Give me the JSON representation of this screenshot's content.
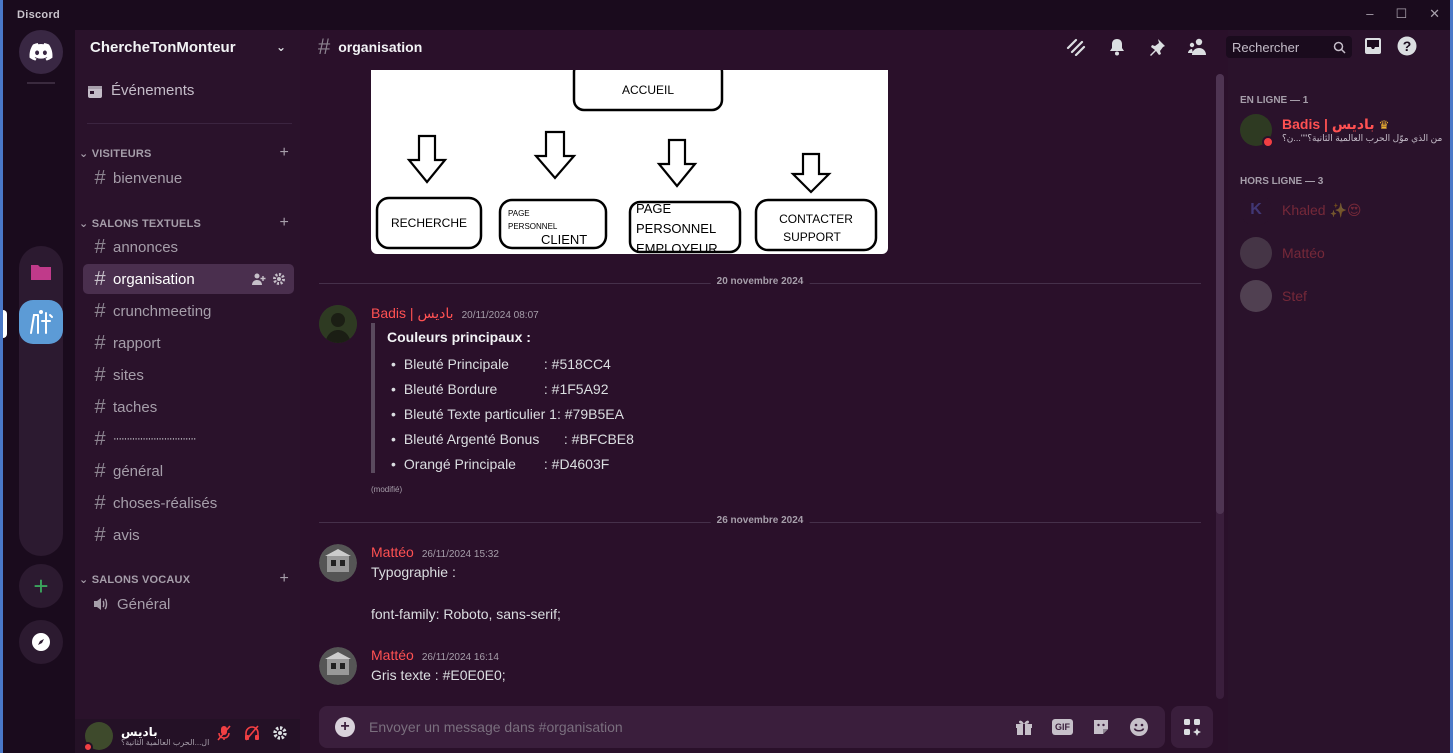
{
  "window": {
    "title": "Discord"
  },
  "server": {
    "name": "ChercheTonMonteur"
  },
  "sidebar": {
    "events_label": "Événements",
    "categories": [
      {
        "label": "VISITEURS",
        "channels": [
          "bienvenue"
        ]
      },
      {
        "label": "SALONS TEXTUELS",
        "channels": [
          "annonces",
          "organisation",
          "crunchmeeting",
          "rapport",
          "sites",
          "taches",
          "·······························",
          "général",
          "choses-réalisés",
          "avis"
        ]
      },
      {
        "label": "SALONS VOCAUX",
        "channels": [
          "Général"
        ]
      }
    ]
  },
  "user": {
    "name": "باديس",
    "status": "ال...الحرب العالمية الثانية؟"
  },
  "channel": {
    "name": "organisation"
  },
  "image": {
    "boxes": [
      "ACCUEIL",
      "RECHERCHE",
      "PAGE PERSONNEL",
      "CLIENT",
      "PAGE PERSONNEL EMPLOYEUR",
      "CONTACTER SUPPORT"
    ]
  },
  "dividers": [
    "20 novembre 2024",
    "26 novembre 2024"
  ],
  "messages": [
    {
      "author": "Badis | باديس",
      "timestamp": "20/11/2024 08:07",
      "quote_title": "Couleurs principaux :",
      "colors": [
        {
          "name": "Bleuté Principale",
          "value": ": #518CC4"
        },
        {
          "name": "Bleuté Bordure",
          "value": ": #1F5A92"
        },
        {
          "name": "Bleuté Texte particulier 1",
          "value": ": #79B5EA"
        },
        {
          "name": "Bleuté Argenté Bonus",
          "value": ": #BFCBE8"
        },
        {
          "name": "Orangé Principale",
          "value": ": #D4603F"
        }
      ],
      "edited": "(modifié)"
    },
    {
      "author": "Mattéo",
      "timestamp": "26/11/2024 15:32",
      "line1": "Typographie :",
      "line2": "font-family: Roboto, sans-serif;"
    },
    {
      "author": "Mattéo",
      "timestamp": "26/11/2024 16:14",
      "text": "Gris texte : #E0E0E0;"
    }
  ],
  "composer": {
    "placeholder": "Envoyer un message dans #organisation",
    "gif_label": "GIF"
  },
  "members": {
    "search_placeholder": "Rechercher",
    "online_header": "EN LIGNE — 1",
    "offline_header": "HORS LIGNE — 3",
    "online": [
      {
        "name": "Badis | باديس",
        "status": "من الذي موّل الحرب العالمية الثانية؟\"\"...ن؟"
      }
    ],
    "offline": [
      {
        "name": "Khaled ✨😍",
        "initial": "K"
      },
      {
        "name": "Mattéo"
      },
      {
        "name": "Stef"
      }
    ]
  },
  "colors": {
    "accent_red": "#ff5152",
    "active_server": "#5c9bd6",
    "background": "#2a102a"
  }
}
